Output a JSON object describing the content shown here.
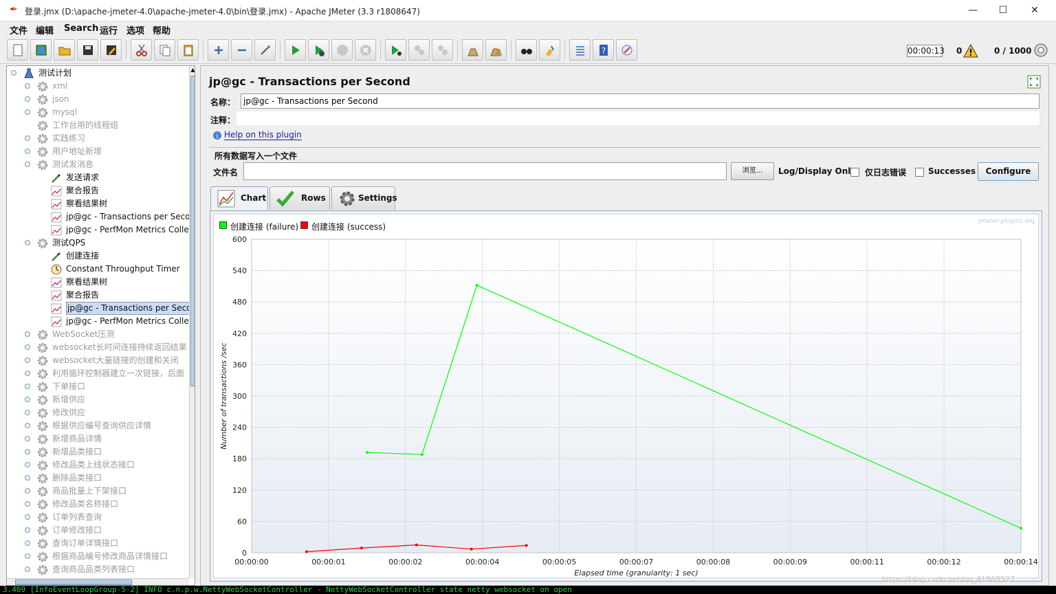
{
  "window": {
    "title": "登录.jmx (D:\\apache-jmeter-4.0\\apache-jmeter-4.0\\bin\\登录.jmx) - Apache JMeter (3.3 r1808647)",
    "minimize": "—",
    "maximize": "☐",
    "close": "✕"
  },
  "menu": [
    "文件",
    "编辑",
    "Search",
    "运行",
    "选项",
    "帮助"
  ],
  "toolbar_status": {
    "timer": "00:00:13",
    "warnings": "0",
    "threads": "0 / 1000"
  },
  "tree": [
    {
      "label": "测试计划",
      "level": 0,
      "icon": "flask-icon",
      "enabled": true,
      "expandable": true
    },
    {
      "label": "xml",
      "level": 1,
      "icon": "gear-icon",
      "enabled": false,
      "expandable": true
    },
    {
      "label": "json",
      "level": 1,
      "icon": "gear-icon",
      "enabled": false,
      "expandable": true
    },
    {
      "label": "mysql",
      "level": 1,
      "icon": "gear-icon",
      "enabled": false,
      "expandable": true
    },
    {
      "label": "工作台用的线程组",
      "level": 1,
      "icon": "gear-icon",
      "enabled": false,
      "expandable": false
    },
    {
      "label": "实践练习",
      "level": 1,
      "icon": "gear-icon",
      "enabled": false,
      "expandable": true
    },
    {
      "label": "用户地址新增",
      "level": 1,
      "icon": "gear-icon",
      "enabled": false,
      "expandable": true
    },
    {
      "label": "测试发消息",
      "level": 1,
      "icon": "gear-icon",
      "enabled": false,
      "expandable": true
    },
    {
      "label": "发送请求",
      "level": 2,
      "icon": "pipette-icon",
      "enabled": true,
      "expandable": false
    },
    {
      "label": "聚合报告",
      "level": 2,
      "icon": "graph-icon",
      "enabled": true,
      "expandable": false
    },
    {
      "label": "察看结果树",
      "level": 2,
      "icon": "graph-icon",
      "enabled": true,
      "expandable": false
    },
    {
      "label": "jp@gc - Transactions per Second",
      "level": 2,
      "icon": "graph-icon",
      "enabled": true,
      "expandable": false
    },
    {
      "label": "jp@gc - PerfMon Metrics Collector",
      "level": 2,
      "icon": "graph-icon",
      "enabled": true,
      "expandable": false
    },
    {
      "label": "测试QPS",
      "level": 1,
      "icon": "gear-icon",
      "enabled": true,
      "expandable": true
    },
    {
      "label": "创建连接",
      "level": 2,
      "icon": "pipette-icon",
      "enabled": true,
      "expandable": false
    },
    {
      "label": "Constant Throughput Timer",
      "level": 2,
      "icon": "timer-icon",
      "enabled": true,
      "expandable": false
    },
    {
      "label": "察看结果树",
      "level": 2,
      "icon": "graph-icon",
      "enabled": true,
      "expandable": false
    },
    {
      "label": "聚合报告",
      "level": 2,
      "icon": "graph-icon",
      "enabled": true,
      "expandable": false
    },
    {
      "label": "jp@gc - Transactions per Second",
      "level": 2,
      "icon": "graph-icon",
      "enabled": true,
      "expandable": false,
      "selected": true
    },
    {
      "label": "jp@gc - PerfMon Metrics Collector",
      "level": 2,
      "icon": "graph-icon",
      "enabled": true,
      "expandable": false
    },
    {
      "label": "WebSocket压测",
      "level": 1,
      "icon": "gear-icon",
      "enabled": false,
      "expandable": true
    },
    {
      "label": "websocket长时间连接持续返回结果",
      "level": 1,
      "icon": "gear-icon",
      "enabled": false,
      "expandable": true
    },
    {
      "label": "websocket大量链接的创建和关闭",
      "level": 1,
      "icon": "gear-icon",
      "enabled": false,
      "expandable": true
    },
    {
      "label": "利用循环控制器建立一次链接，后面",
      "level": 1,
      "icon": "gear-icon",
      "enabled": false,
      "expandable": true
    },
    {
      "label": "下单接口",
      "level": 1,
      "icon": "gear-icon",
      "enabled": false,
      "expandable": true
    },
    {
      "label": "新增供应",
      "level": 1,
      "icon": "gear-icon",
      "enabled": false,
      "expandable": true
    },
    {
      "label": "修改供应",
      "level": 1,
      "icon": "gear-icon",
      "enabled": false,
      "expandable": true
    },
    {
      "label": "根据供应编号查询供应详情",
      "level": 1,
      "icon": "gear-icon",
      "enabled": false,
      "expandable": true
    },
    {
      "label": "新增商品详情",
      "level": 1,
      "icon": "gear-icon",
      "enabled": false,
      "expandable": true
    },
    {
      "label": "新增品类接口",
      "level": 1,
      "icon": "gear-icon",
      "enabled": false,
      "expandable": true
    },
    {
      "label": "修改品类上线状态接口",
      "level": 1,
      "icon": "gear-icon",
      "enabled": false,
      "expandable": true
    },
    {
      "label": "删除品类接口",
      "level": 1,
      "icon": "gear-icon",
      "enabled": false,
      "expandable": true
    },
    {
      "label": "商品批量上下架接口",
      "level": 1,
      "icon": "gear-icon",
      "enabled": false,
      "expandable": true
    },
    {
      "label": "修改品类名称接口",
      "level": 1,
      "icon": "gear-icon",
      "enabled": false,
      "expandable": true
    },
    {
      "label": "订单列表查询",
      "level": 1,
      "icon": "gear-icon",
      "enabled": false,
      "expandable": true
    },
    {
      "label": "订单修改接口",
      "level": 1,
      "icon": "gear-icon",
      "enabled": false,
      "expandable": true
    },
    {
      "label": "查询订单详情接口",
      "level": 1,
      "icon": "gear-icon",
      "enabled": false,
      "expandable": true
    },
    {
      "label": "根据商品编号修改商品详情接口",
      "level": 1,
      "icon": "gear-icon",
      "enabled": false,
      "expandable": true
    },
    {
      "label": "查询商品品类列表接口",
      "level": 1,
      "icon": "gear-icon",
      "enabled": false,
      "expandable": true
    }
  ],
  "panel": {
    "title": "jp@gc - Transactions per Second",
    "name_label": "名称：",
    "name_value": "jp@gc - Transactions per Second",
    "comment_label": "注释：",
    "help_link": "Help on this plugin",
    "file_group_title": "所有数据写入一个文件",
    "file_label": "文件名",
    "browse_button": "浏览...",
    "log_display_label": "Log/Display Only:",
    "errors_only_label": "仅日志错误",
    "successes_label": "Successes",
    "configure_button": "Configure",
    "tabs": [
      "Chart",
      "Rows",
      "Settings"
    ],
    "watermark": "jmeter-plugins.org"
  },
  "chart_data": {
    "type": "line",
    "xlabel": "Elapsed time (granularity: 1 sec)",
    "ylabel": "Number of transactions /sec",
    "ylim": [
      0,
      600
    ],
    "yticks": [
      0,
      60,
      120,
      180,
      240,
      300,
      360,
      420,
      480,
      540,
      600
    ],
    "xlim": [
      0,
      14
    ],
    "xtick_labels": [
      "00:00:00",
      "00:00:01",
      "00:00:02",
      "00:00:04",
      "00:00:05",
      "00:00:07",
      "00:00:08",
      "00:00:09",
      "00:00:11",
      "00:00:12",
      "00:00:14"
    ],
    "grid": true,
    "legend": "top-left",
    "series": [
      {
        "name": "创建连接 (failure)",
        "color": "#00ff00",
        "x": [
          2.1,
          3.1,
          4.1,
          14.0
        ],
        "y": [
          192,
          188,
          512,
          47
        ]
      },
      {
        "name": "创建连接 (success)",
        "color": "#ff0000",
        "x": [
          1.0,
          2.0,
          3.0,
          4.0,
          5.0
        ],
        "y": [
          2,
          9,
          15,
          7,
          14
        ]
      }
    ]
  },
  "log_line": "3.409 [InfoEventLoopGroup-5-2] INFO  c.n.p.w.NettyWebSocketController - NettyWebSocketController state netty websocket on open",
  "blog_watermark": "https://blog.csdn.net/qq_41868527"
}
